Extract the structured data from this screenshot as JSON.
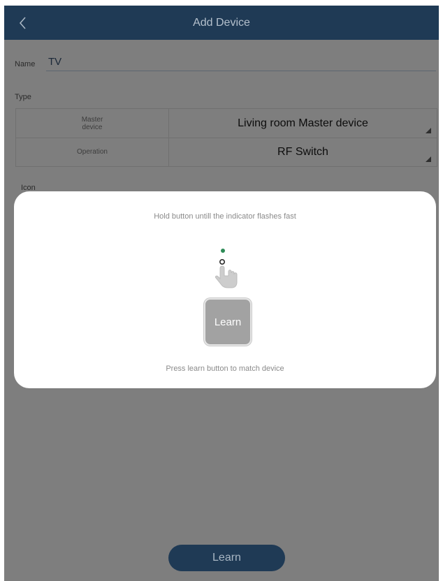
{
  "header": {
    "title": "Add Device",
    "back_icon": "chevron-left-icon"
  },
  "form": {
    "name_label": "Name",
    "name_value": "TV",
    "type_label": "Type",
    "type_rows": [
      {
        "label": "Master device",
        "value": "Living room Master device"
      },
      {
        "label": "Operation",
        "value": "RF Switch"
      }
    ],
    "icon_label": "Icon"
  },
  "dialog": {
    "instruction_top": "Hold button untill the indicator flashes fast",
    "indicator_icon": "indicator-led-icon",
    "hand_icon": "hand-pointer-icon",
    "learn_label": "Learn",
    "instruction_bottom": "Press learn button to match device"
  },
  "footer": {
    "learn_label": "Learn"
  },
  "colors": {
    "header_bg": "#1f3a55",
    "dim_overlay": "#7e7e7e",
    "indicator_green": "#2e8b57",
    "learn_square_bg": "#a2a2a2"
  }
}
